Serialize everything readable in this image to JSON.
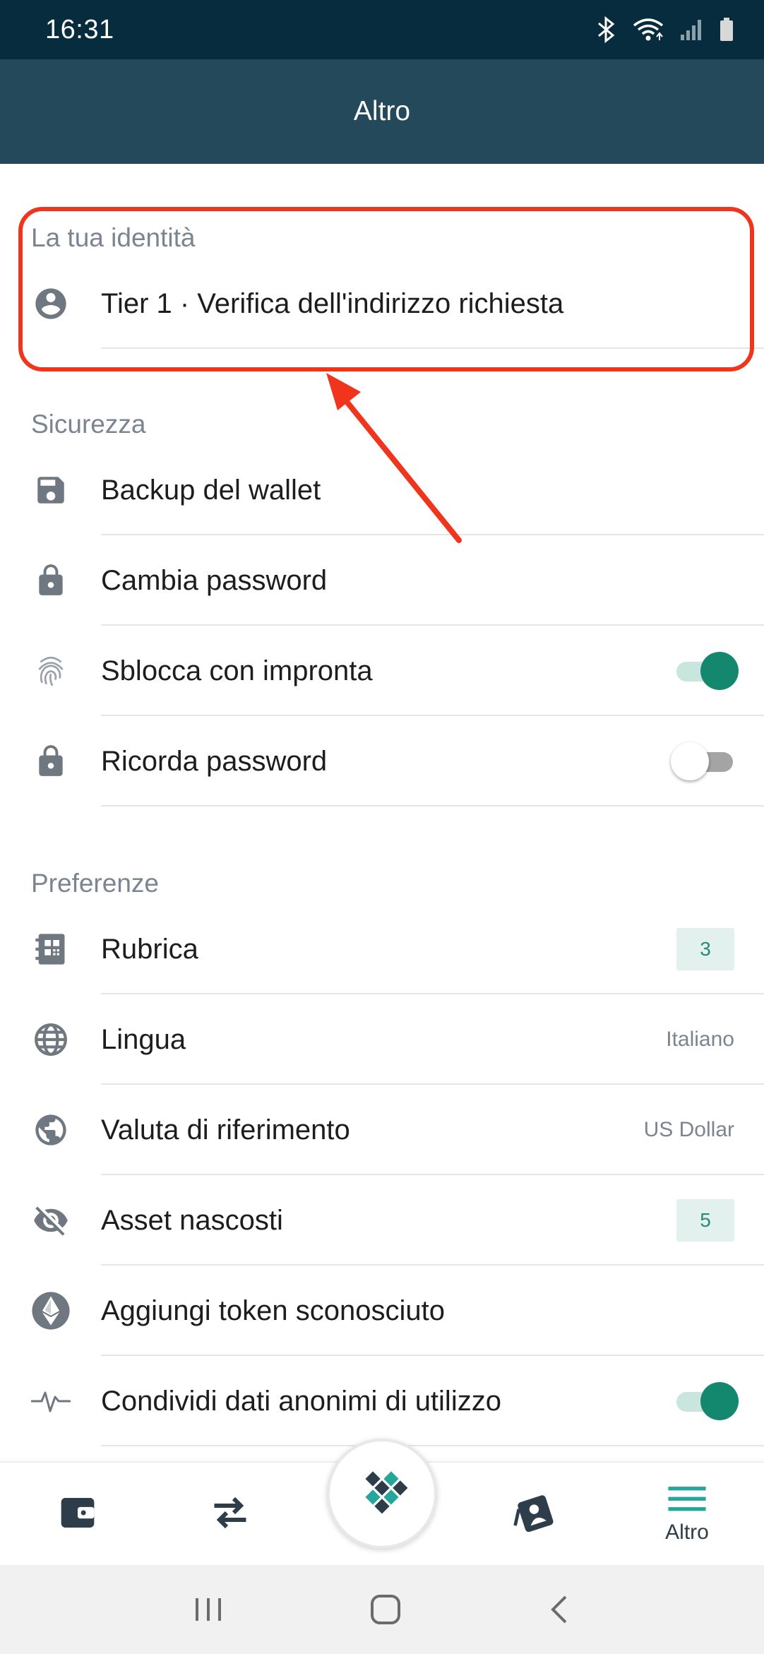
{
  "status_bar": {
    "time": "16:31"
  },
  "app_bar": {
    "title": "Altro"
  },
  "identity": {
    "header": "La tua identità",
    "item_label": "Tier 1 · Verifica dell'indirizzo richiesta"
  },
  "security": {
    "header": "Sicurezza",
    "items": [
      {
        "label": "Backup del wallet",
        "icon": "save-icon"
      },
      {
        "label": "Cambia password",
        "icon": "lock-icon"
      },
      {
        "label": "Sblocca con impronta",
        "icon": "fingerprint-icon",
        "toggle": true
      },
      {
        "label": "Ricorda password",
        "icon": "lock-icon",
        "toggle": false
      }
    ]
  },
  "preferences": {
    "header": "Preferenze",
    "items": [
      {
        "label": "Rubrica",
        "icon": "address-book-icon",
        "badge": "3"
      },
      {
        "label": "Lingua",
        "icon": "globe-icon",
        "value": "Italiano"
      },
      {
        "label": "Valuta di riferimento",
        "icon": "public-globe-icon",
        "value": "US Dollar"
      },
      {
        "label": "Asset nascosti",
        "icon": "eye-off-icon",
        "badge": "5"
      },
      {
        "label": "Aggiungi token sconosciuto",
        "icon": "ethereum-icon"
      },
      {
        "label": "Condividi dati anonimi di utilizzo",
        "icon": "pulse-icon",
        "toggle": true
      }
    ]
  },
  "bottom_nav": {
    "items": [
      {
        "icon": "wallet-icon"
      },
      {
        "icon": "swap-icon"
      },
      {
        "icon": "logo-icon"
      },
      {
        "icon": "cards-icon"
      },
      {
        "icon": "menu-icon",
        "label": "Altro",
        "active": true
      }
    ]
  },
  "colors": {
    "status_bar": "#072c3d",
    "app_bar": "#23495a",
    "accent": "#14876f",
    "highlight": "#f1341c",
    "section_header": "#7b8591"
  }
}
